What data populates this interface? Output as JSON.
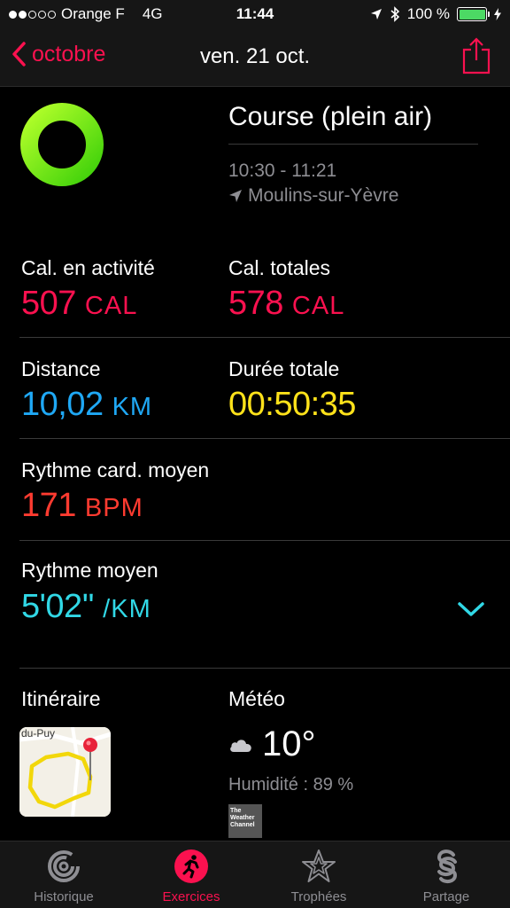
{
  "status_bar": {
    "carrier": "Orange F",
    "network": "4G",
    "time": "11:44",
    "battery": "100 %"
  },
  "nav": {
    "back_label": "octobre",
    "title": "ven. 21 oct."
  },
  "workout": {
    "title": "Course (plein air)",
    "time_range": "10:30 - 11:21",
    "location": "Moulins-sur-Yèvre"
  },
  "metrics": {
    "active_cal": {
      "label": "Cal. en activité",
      "value": "507",
      "unit": "CAL",
      "color": "#fa114f"
    },
    "total_cal": {
      "label": "Cal. totales",
      "value": "578",
      "unit": "CAL",
      "color": "#fa114f"
    },
    "distance": {
      "label": "Distance",
      "value": "10,02",
      "unit": "KM",
      "color": "#1fa8f5"
    },
    "duration": {
      "label": "Durée totale",
      "value": "00:50:35",
      "color": "#ffe21a"
    },
    "heart_rate": {
      "label": "Rythme card. moyen",
      "value": "171",
      "unit": "BPM",
      "color": "#ff3b30"
    },
    "pace": {
      "label": "Rythme moyen",
      "value": "5'02''",
      "unit": "/KM",
      "color": "#31d8e6"
    }
  },
  "route": {
    "label": "Itinéraire",
    "map_text": "du-Puy"
  },
  "weather": {
    "label": "Météo",
    "icon": "cloud-icon",
    "temperature": "10°",
    "humidity": "Humidité : 89 %",
    "logo_text": "The Weather Channel"
  },
  "tabs": [
    {
      "label": "Historique",
      "icon": "history-icon",
      "active": false
    },
    {
      "label": "Exercices",
      "icon": "running-icon",
      "active": true
    },
    {
      "label": "Trophées",
      "icon": "trophy-star-icon",
      "active": false
    },
    {
      "label": "Partage",
      "icon": "sharing-icon",
      "active": false
    }
  ],
  "colors": {
    "accent": "#fa114f",
    "ring_green": "#8ff21a",
    "secondary_text": "#8e8e93",
    "chevron": "#31d8e6"
  }
}
